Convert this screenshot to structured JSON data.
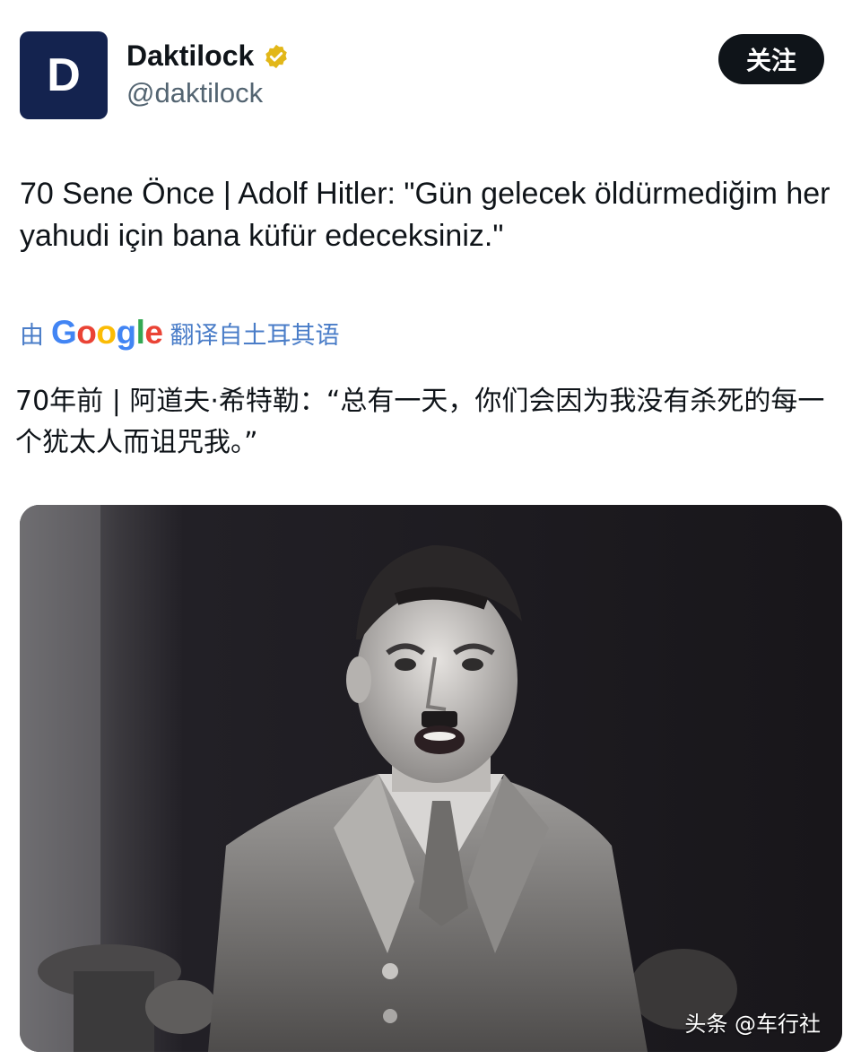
{
  "account": {
    "avatar_text": "D",
    "name": "Daktilock",
    "handle": "@daktilock",
    "verified_icon": "verified-badge-icon"
  },
  "follow_label": "关注",
  "tweet": {
    "text": "70 Sene Önce | Adolf Hitler: \"Gün gelecek öldürmediğim her yahudi için bana küfür edeceksiniz.\""
  },
  "translation": {
    "prefix": "由",
    "service": "Google",
    "suffix": "翻译自土耳其语",
    "text": "70年前 | 阿道夫·希特勒：“总有一天，你们会因为我没有杀死的每一个犹太人而诅咒我。”"
  },
  "media": {
    "watermark": "头条 @车行社"
  },
  "colors": {
    "avatar_bg": "#14234f",
    "translate_link": "#4a7dc8",
    "handle": "#536471"
  }
}
